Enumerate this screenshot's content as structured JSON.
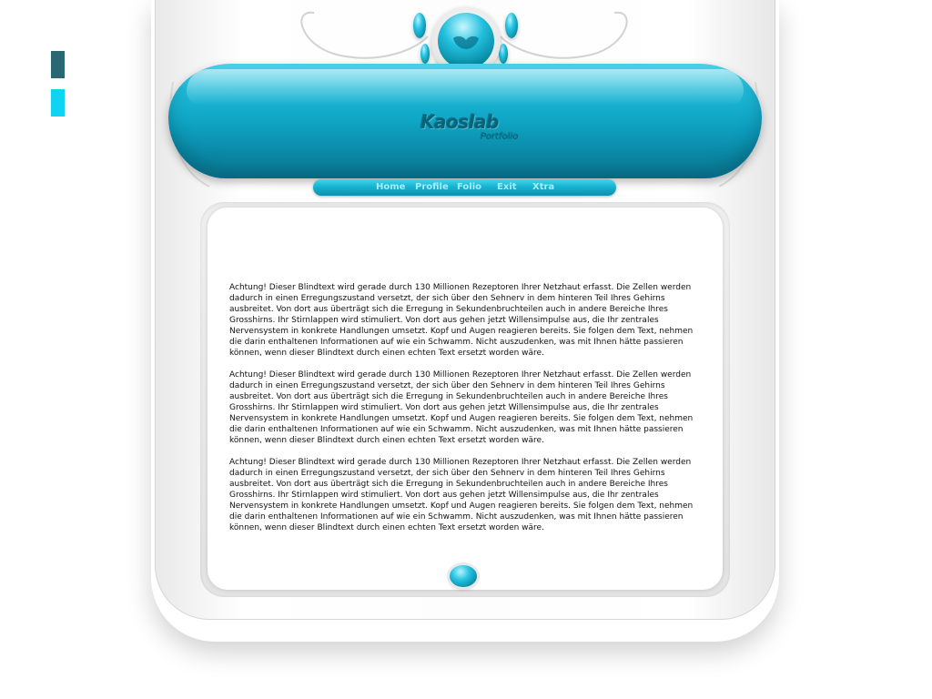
{
  "brand": {
    "name": "Kaoslab",
    "tagline": "Portfolio"
  },
  "nav": {
    "items": [
      {
        "label": "Home"
      },
      {
        "label": "Profile"
      },
      {
        "label": "Folio"
      },
      {
        "label": "Exit"
      },
      {
        "label": "Xtra"
      }
    ]
  },
  "content": {
    "paragraphs": [
      "Achtung! Dieser Blindtext wird gerade durch 130 Millionen Rezeptoren Ihrer Netzhaut erfasst. Die Zellen werden dadurch in einen Erregungszustand versetzt, der sich über den Sehnerv in dem hinteren Teil Ihres Gehirns ausbreitet. Von dort aus überträgt sich die Erregung in Sekundenbruchteilen auch in andere Bereiche Ihres Grosshirns. Ihr Stirnlappen wird stimuliert. Von dort aus gehen jetzt Willensimpulse aus, die Ihr zentrales Nervensystem in konkrete Handlungen umsetzt. Kopf und Augen reagieren bereits. Sie folgen dem Text, nehmen die darin enthaltenen Informationen auf wie ein Schwamm. Nicht auszudenken, was mit Ihnen hätte passieren können, wenn dieser Blindtext durch einen echten Text ersetzt worden wäre.",
      "Achtung! Dieser Blindtext wird gerade durch 130 Millionen Rezeptoren Ihrer Netzhaut erfasst. Die Zellen werden dadurch in einen Erregungszustand versetzt, der sich über den Sehnerv in dem hinteren Teil Ihres Gehirns ausbreitet. Von dort aus überträgt sich die Erregung in Sekundenbruchteilen auch in andere Bereiche Ihres Grosshirns. Ihr Stirnlappen wird stimuliert. Von dort aus gehen jetzt Willensimpulse aus, die Ihr zentrales Nervensystem in konkrete Handlungen umsetzt. Kopf und Augen reagieren bereits. Sie folgen dem Text, nehmen die darin enthaltenen Informationen auf wie ein Schwamm. Nicht auszudenken, was mit Ihnen hätte passieren können, wenn dieser Blindtext durch einen echten Text ersetzt worden wäre.",
      "Achtung! Dieser Blindtext wird gerade durch 130 Millionen Rezeptoren Ihrer Netzhaut erfasst. Die Zellen werden dadurch in einen Erregungszustand versetzt, der sich über den Sehnerv in dem hinteren Teil Ihres Gehirns ausbreitet. Von dort aus überträgt sich die Erregung in Sekundenbruchteilen auch in andere Bereiche Ihres Grosshirns. Ihr Stirnlappen wird stimuliert. Von dort aus gehen jetzt Willensimpulse aus, die Ihr zentrales Nervensystem in konkrete Handlungen umsetzt. Kopf und Augen reagieren bereits. Sie folgen dem Text, nehmen die darin enthaltenen Informationen auf wie ein Schwamm. Nicht auszudenken, was mit Ihnen hätte passieren können, wenn dieser Blindtext durch einen echten Text ersetzt worden wäre."
    ]
  },
  "swatches": [
    "#2b6673",
    "#10d2f2"
  ],
  "colors": {
    "accent": "#17b5d3",
    "accent_dark": "#0a7f99",
    "nav_text": "#a8ecfa",
    "frame": "#f6f6f6"
  },
  "icons": [
    "orb-icon",
    "pod-icon"
  ]
}
